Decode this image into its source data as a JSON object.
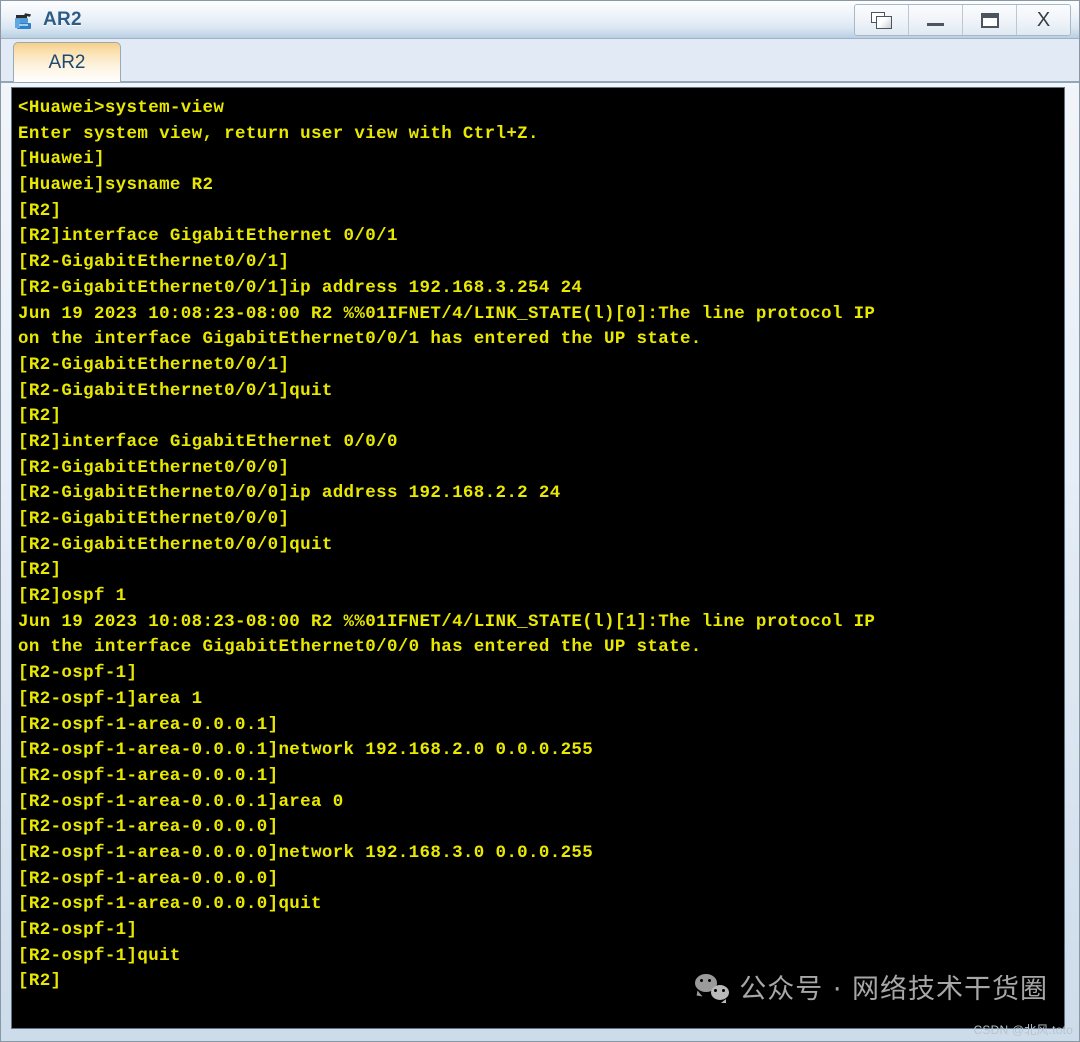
{
  "window": {
    "title": "AR2",
    "icon": "router-icon",
    "controls": [
      {
        "name": "cascade-windows-button",
        "icon": "cascade-windows-icon",
        "label": ""
      },
      {
        "name": "minimize-button",
        "icon": "minimize-icon",
        "label": ""
      },
      {
        "name": "maximize-button",
        "icon": "maximize-icon",
        "label": ""
      },
      {
        "name": "close-button",
        "icon": "close-icon",
        "label": "X"
      }
    ]
  },
  "tabs": [
    {
      "label": "AR2",
      "active": true
    }
  ],
  "terminal": {
    "background_color": "#000000",
    "text_color": "#e8e800",
    "lines": [
      "<Huawei>system-view",
      "Enter system view, return user view with Ctrl+Z.",
      "[Huawei]",
      "[Huawei]sysname R2",
      "[R2]",
      "[R2]interface GigabitEthernet 0/0/1",
      "[R2-GigabitEthernet0/0/1]",
      "[R2-GigabitEthernet0/0/1]ip address 192.168.3.254 24",
      "Jun 19 2023 10:08:23-08:00 R2 %%01IFNET/4/LINK_STATE(l)[0]:The line protocol IP",
      "on the interface GigabitEthernet0/0/1 has entered the UP state.",
      "[R2-GigabitEthernet0/0/1]",
      "[R2-GigabitEthernet0/0/1]quit",
      "[R2]",
      "[R2]interface GigabitEthernet 0/0/0",
      "[R2-GigabitEthernet0/0/0]",
      "[R2-GigabitEthernet0/0/0]ip address 192.168.2.2 24",
      "[R2-GigabitEthernet0/0/0]",
      "[R2-GigabitEthernet0/0/0]quit",
      "[R2]",
      "[R2]ospf 1",
      "Jun 19 2023 10:08:23-08:00 R2 %%01IFNET/4/LINK_STATE(l)[1]:The line protocol IP",
      "on the interface GigabitEthernet0/0/0 has entered the UP state.",
      "[R2-ospf-1]",
      "[R2-ospf-1]area 1",
      "[R2-ospf-1-area-0.0.0.1]",
      "[R2-ospf-1-area-0.0.0.1]network 192.168.2.0 0.0.0.255",
      "[R2-ospf-1-area-0.0.0.1]",
      "[R2-ospf-1-area-0.0.0.1]area 0",
      "[R2-ospf-1-area-0.0.0.0]",
      "[R2-ospf-1-area-0.0.0.0]network 192.168.3.0 0.0.0.255",
      "[R2-ospf-1-area-0.0.0.0]",
      "[R2-ospf-1-area-0.0.0.0]quit",
      "[R2-ospf-1]",
      "[R2-ospf-1]quit",
      "[R2]"
    ]
  },
  "watermark": {
    "icon": "wechat-icon",
    "text": "公众号 · 网络技术干货圈"
  },
  "attribution": {
    "text": "CSDN @北风.toto"
  }
}
